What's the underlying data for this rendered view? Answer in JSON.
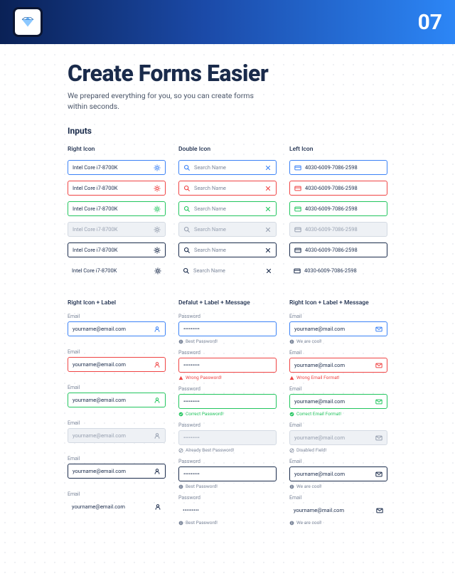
{
  "header": {
    "page_number": "07"
  },
  "title": "Create Forms Easier",
  "subtitle": "We prepared everything for you, so you can create forms within seconds.",
  "section_heading": "Inputs",
  "columns_top": {
    "right_icon": {
      "title": "Right Icon",
      "value": "Intel Core i7-8700K"
    },
    "double_icon": {
      "title": "Double Icon",
      "placeholder": "Search Name"
    },
    "left_icon": {
      "title": "Left Icon",
      "value": "4030-6009-7086-2598"
    }
  },
  "columns_bottom": {
    "left": {
      "title": "Right Icon + Label",
      "label": "Email",
      "value": "yourname@email.com"
    },
    "mid": {
      "title": "Defalut + Label + Message",
      "label": "Password",
      "value": "•••••••••",
      "msg_best": "Best Password!",
      "msg_wrong": "Wrong Password!",
      "msg_correct": "Correct Password!",
      "msg_already": "Already Best Password!"
    },
    "right": {
      "title": "Right Icon + Label + Message",
      "label": "Email",
      "value": "yourname@mail.com",
      "msg_cool": "We are cool!",
      "msg_wrong": "Wrong Email Format!",
      "msg_correct": "Correct Email Format!",
      "msg_disabled": "Disabled Field!"
    }
  }
}
